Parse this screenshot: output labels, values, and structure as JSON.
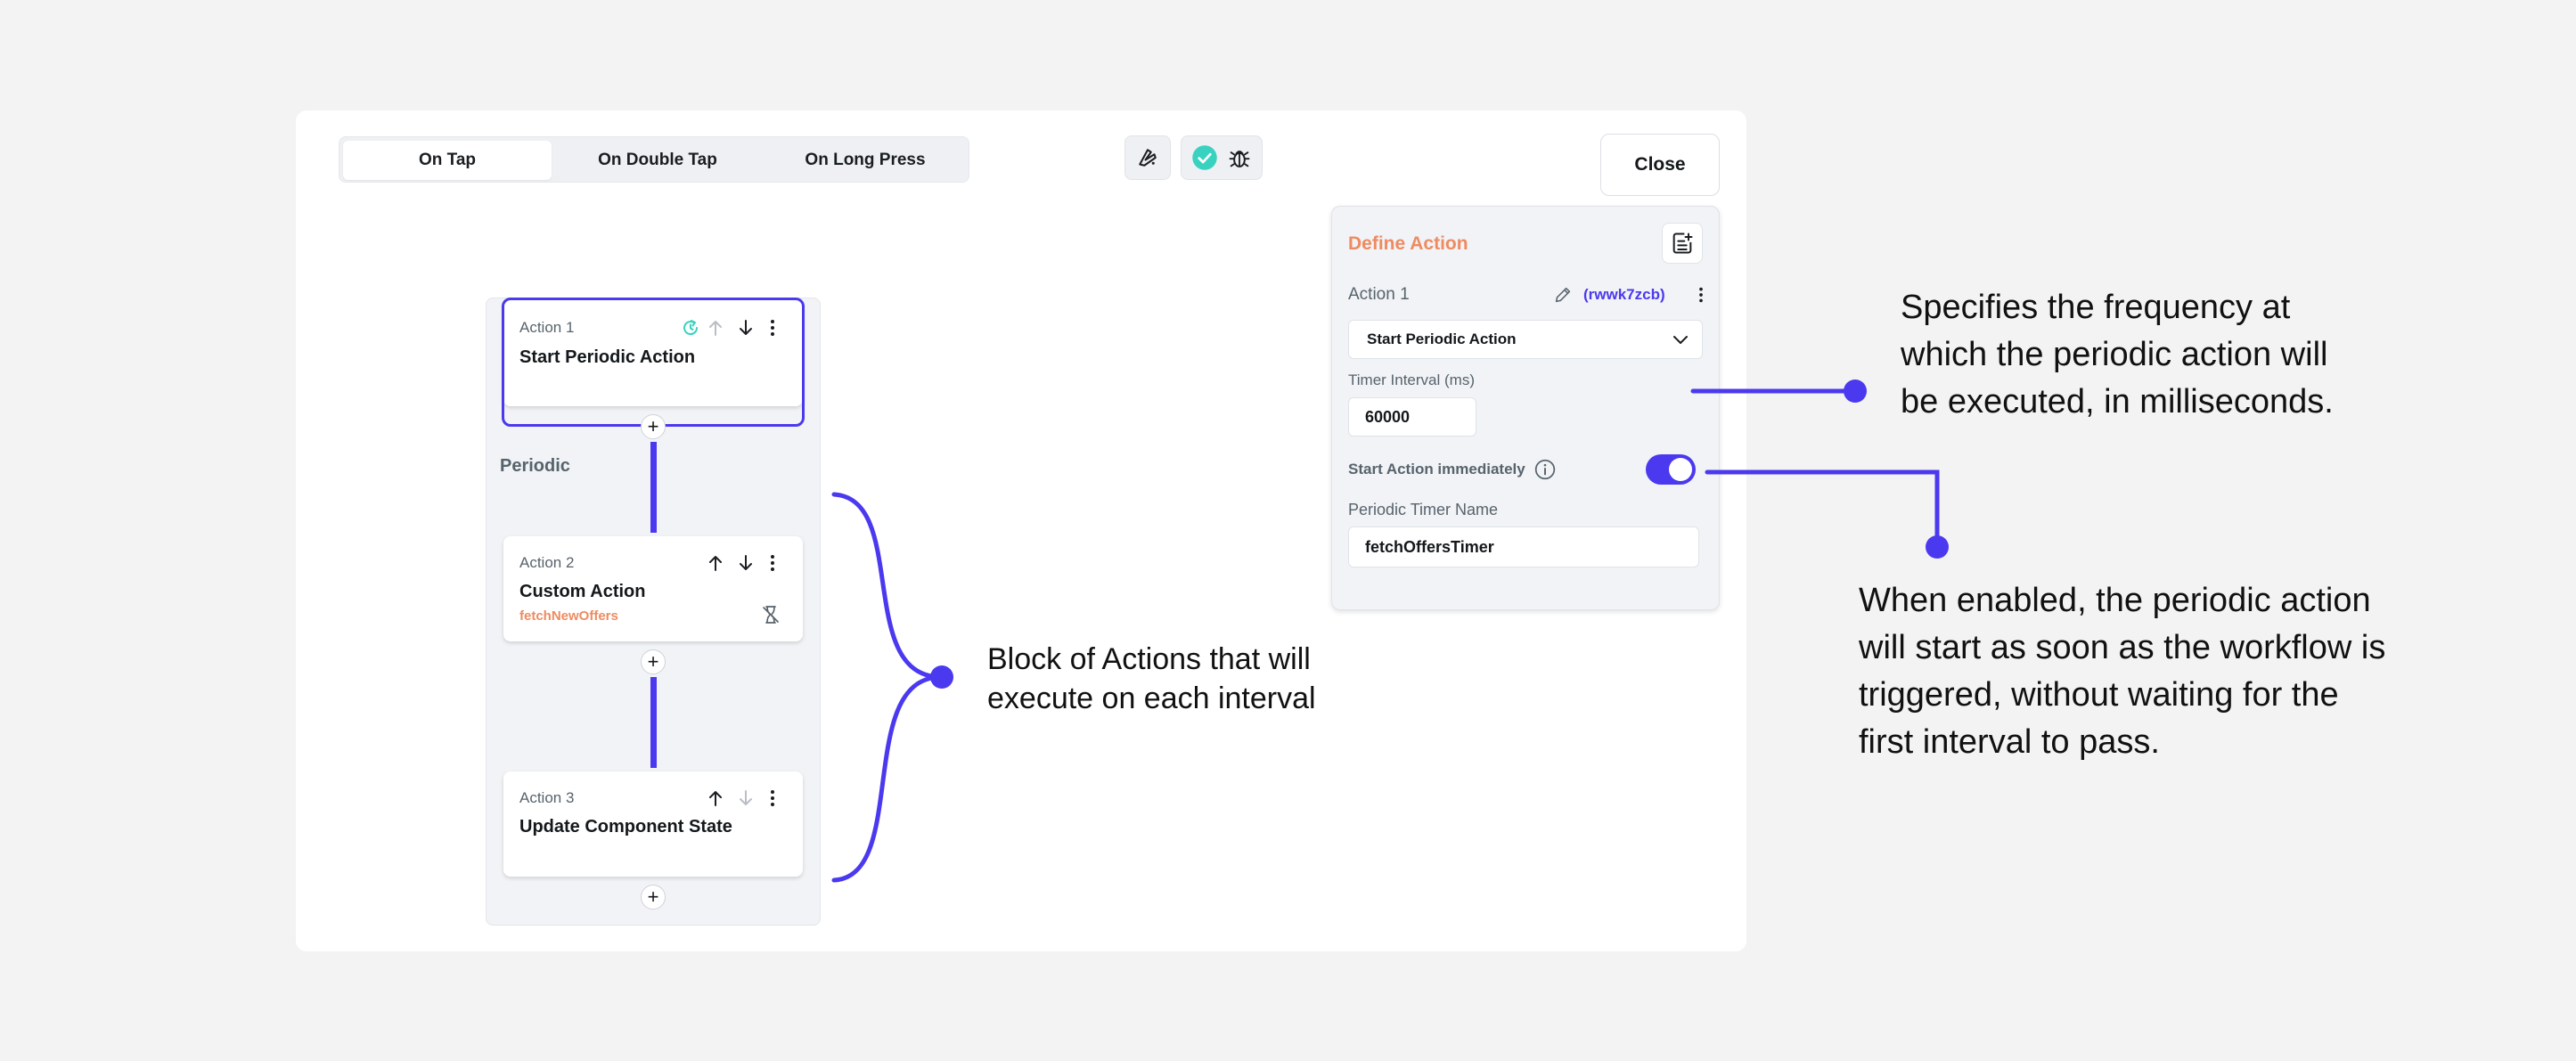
{
  "tabs": [
    {
      "label": "On Tap",
      "selected": true
    },
    {
      "label": "On Double Tap",
      "selected": false
    },
    {
      "label": "On Long Press",
      "selected": false
    }
  ],
  "toolbar": {
    "close_label": "Close"
  },
  "icons": {
    "flutterflow": "flutterflow-logo-icon",
    "check": "check-circle-icon",
    "bug": "bug-icon",
    "periodic": "periodic-refresh-icon",
    "up": "arrow-up-icon",
    "down": "arrow-down-icon",
    "more": "more-vertical-icon",
    "hourglass_off": "hourglass-disabled-icon",
    "edit": "pencil-icon",
    "chevron": "chevron-down-icon",
    "info": "info-icon",
    "note_add": "note-add-icon",
    "plus": "plus-icon"
  },
  "colors": {
    "accent": "#4b39ef",
    "orange": "#ee8b60",
    "teal": "#39d2c0"
  },
  "actions": [
    {
      "label": "Action 1",
      "title": "Start Periodic Action"
    },
    {
      "label": "Action 2",
      "title": "Custom Action",
      "subtitle": "fetchNewOffers"
    },
    {
      "label": "Action 3",
      "title": "Update Component State"
    }
  ],
  "periodic_label": "Periodic",
  "plus": "+",
  "define_action": {
    "title": "Define Action",
    "action_label": "Action 1",
    "action_id": "(rwwk7zcb)",
    "selected_action": "Start Periodic Action",
    "timer_interval_label": "Timer Interval (ms)",
    "timer_interval_value": "60000",
    "start_immediately_label": "Start Action immediately",
    "start_immediately_on": true,
    "timer_name_label": "Periodic Timer Name",
    "timer_name_value": "fetchOffersTimer"
  },
  "annotations": {
    "blocks": [
      "Block of Actions that will",
      "execute on each interval"
    ],
    "frequency": [
      "Specifies the frequency at",
      "which the periodic action will",
      "be executed, in milliseconds."
    ],
    "immediately": [
      "When enabled, the periodic action",
      "will start as soon as the workflow is",
      "triggered, without waiting for the",
      "first interval to pass."
    ]
  }
}
